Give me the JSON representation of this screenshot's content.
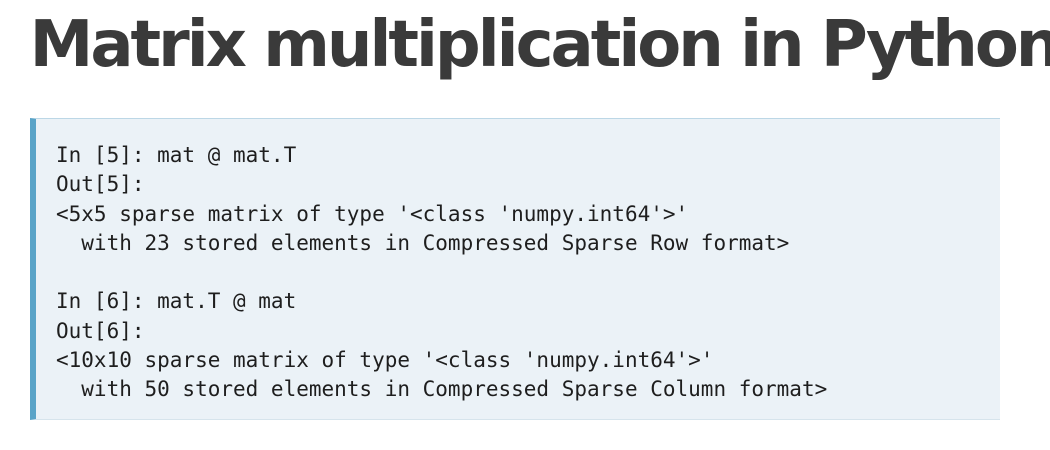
{
  "title": "Matrix multiplication in Python",
  "code_block": {
    "lines": [
      "In [5]: mat @ mat.T",
      "Out[5]:",
      "<5x5 sparse matrix of type '<class 'numpy.int64'>'",
      "  with 23 stored elements in Compressed Sparse Row format>",
      "",
      "In [6]: mat.T @ mat",
      "Out[6]:",
      "<10x10 sparse matrix of type '<class 'numpy.int64'>'",
      "  with 50 stored elements in Compressed Sparse Column format>"
    ]
  }
}
